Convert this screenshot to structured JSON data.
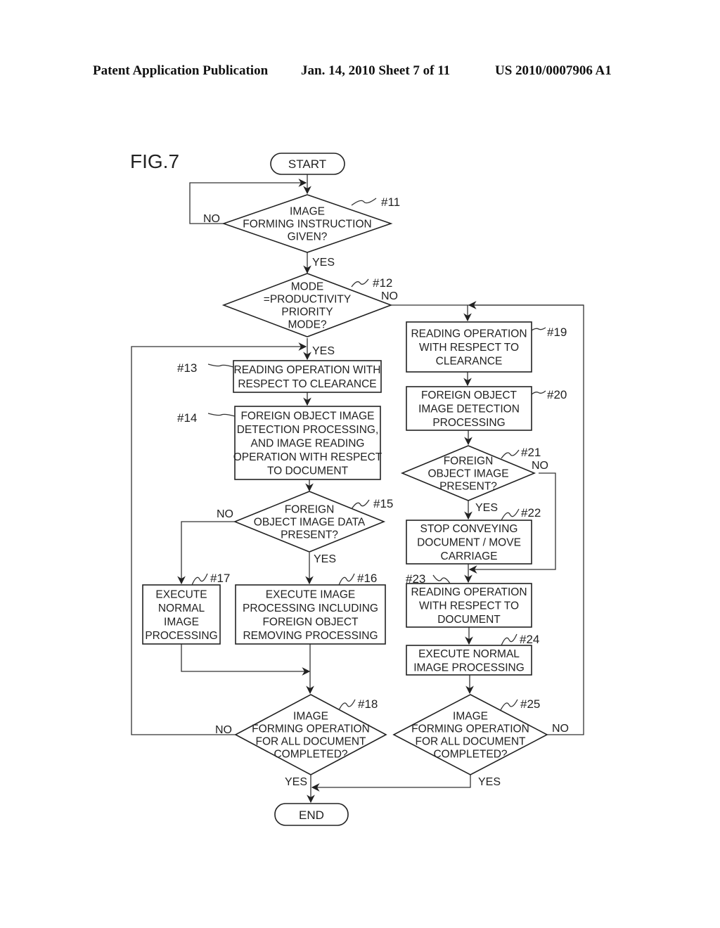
{
  "header": {
    "publication": "Patent Application Publication",
    "date_sheet": "Jan. 14, 2010  Sheet 7 of 11",
    "number": "US 2010/0007906 A1"
  },
  "figure_label": "FIG.7",
  "nodes": {
    "start": {
      "text": "START"
    },
    "end": {
      "text": "END"
    },
    "s11": {
      "tag": "#11",
      "lines": [
        "IMAGE",
        "FORMING INSTRUCTION",
        "GIVEN?"
      ]
    },
    "s12": {
      "tag": "#12",
      "lines": [
        "MODE",
        "=PRODUCTIVITY",
        "PRIORITY",
        "MODE?"
      ]
    },
    "s13": {
      "tag": "#13",
      "lines": [
        "READING OPERATION WITH",
        "RESPECT TO CLEARANCE"
      ]
    },
    "s14": {
      "tag": "#14",
      "lines": [
        "FOREIGN OBJECT IMAGE",
        "DETECTION PROCESSING,",
        "AND IMAGE READING",
        "OPERATION WITH RESPECT",
        "TO DOCUMENT"
      ]
    },
    "s15": {
      "tag": "#15",
      "lines": [
        "FOREIGN",
        "OBJECT IMAGE DATA",
        "PRESENT?"
      ]
    },
    "s16": {
      "tag": "#16",
      "lines": [
        "EXECUTE IMAGE",
        "PROCESSING INCLUDING",
        "FOREIGN OBJECT",
        "REMOVING PROCESSING"
      ]
    },
    "s17": {
      "tag": "#17",
      "lines": [
        "EXECUTE",
        "NORMAL",
        "IMAGE",
        "PROCESSING"
      ]
    },
    "s18": {
      "tag": "#18",
      "lines": [
        "IMAGE",
        "FORMING OPERATION",
        "FOR ALL DOCUMENT",
        "COMPLETED?"
      ]
    },
    "s19": {
      "tag": "#19",
      "lines": [
        "READING OPERATION",
        "WITH RESPECT TO",
        "CLEARANCE"
      ]
    },
    "s20": {
      "tag": "#20",
      "lines": [
        "FOREIGN OBJECT",
        "IMAGE DETECTION",
        "PROCESSING"
      ]
    },
    "s21": {
      "tag": "#21",
      "lines": [
        "FOREIGN",
        "OBJECT IMAGE",
        "PRESENT?"
      ]
    },
    "s22": {
      "tag": "#22",
      "lines": [
        "STOP CONVEYING",
        "DOCUMENT / MOVE",
        "CARRIAGE"
      ]
    },
    "s23": {
      "tag": "#23",
      "lines": [
        "READING OPERATION",
        "WITH RESPECT TO",
        "DOCUMENT"
      ]
    },
    "s24": {
      "tag": "#24",
      "lines": [
        "EXECUTE NORMAL",
        "IMAGE PROCESSING"
      ]
    },
    "s25": {
      "tag": "#25",
      "lines": [
        "IMAGE",
        "FORMING OPERATION",
        "FOR ALL DOCUMENT",
        "COMPLETED?"
      ]
    }
  },
  "branch_labels": {
    "s11_no": "NO",
    "s11_yes": "YES",
    "s12_no": "NO",
    "s12_yes": "YES",
    "s15_no": "NO",
    "s15_yes": "YES",
    "s18_no": "NO",
    "s18_yes": "YES",
    "s21_no": "NO",
    "s21_yes": "YES",
    "s25_no": "NO",
    "s25_yes": "YES"
  }
}
